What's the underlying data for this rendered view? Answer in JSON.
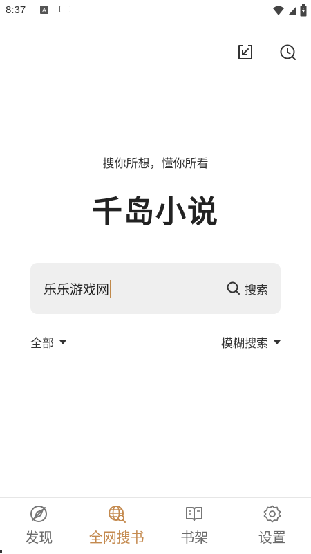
{
  "status_bar": {
    "time": "8:37"
  },
  "header": {
    "import_icon": "download-tray-icon",
    "history_icon": "clock-history-icon"
  },
  "slogan": "搜你所想，懂你所看",
  "app_title": "千岛小说",
  "search": {
    "value": "乐乐游戏网",
    "button_label": "搜索"
  },
  "filters": {
    "scope": "全部",
    "mode": "模糊搜索"
  },
  "bottom_nav": {
    "items": [
      {
        "label": "发现",
        "icon": "compass-icon",
        "active": false
      },
      {
        "label": "全网搜书",
        "icon": "globe-search-icon",
        "active": true
      },
      {
        "label": "书架",
        "icon": "open-book-icon",
        "active": false
      },
      {
        "label": "设置",
        "icon": "gear-icon",
        "active": false
      }
    ]
  },
  "colors": {
    "accent": "#c48a4f",
    "search_bg": "#efefef"
  }
}
